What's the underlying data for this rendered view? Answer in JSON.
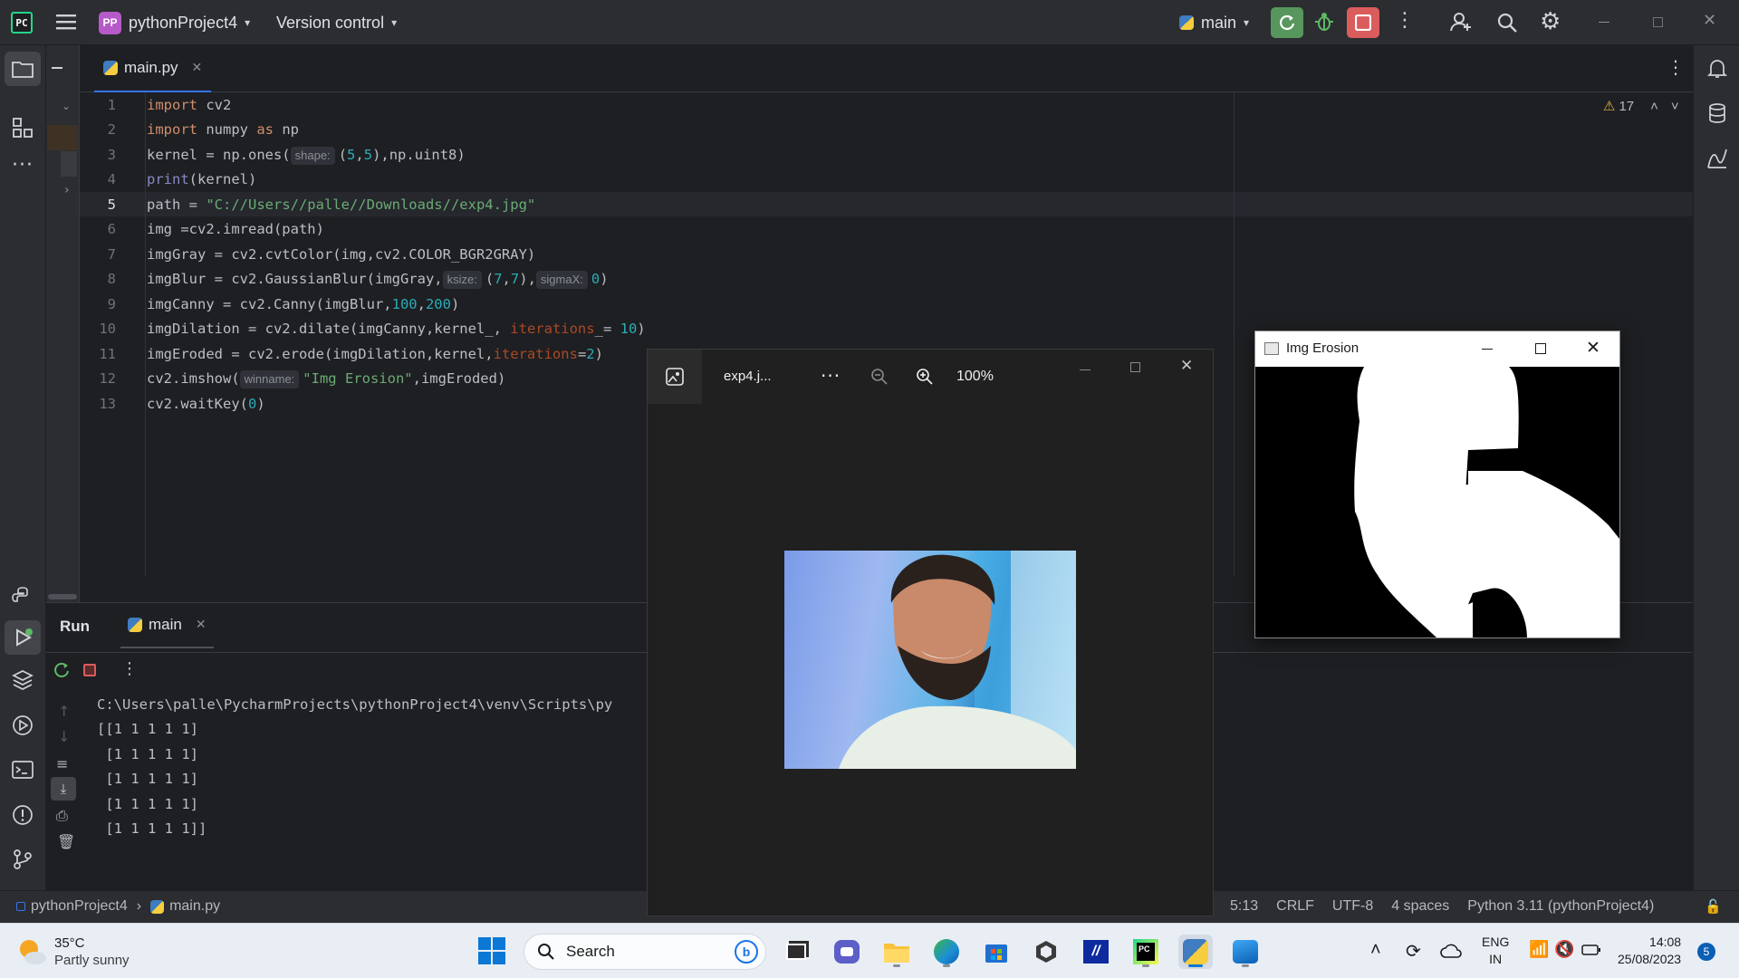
{
  "titlebar": {
    "project_badge": "PP",
    "project_name": "pythonProject4",
    "vcs_label": "Version control",
    "run_config": "main",
    "colors": {
      "accent_green": "#57965c",
      "stop_red": "#db5c5c",
      "badge_purple": "#b659c9"
    }
  },
  "editor": {
    "tab_label": "main.py",
    "warnings_count": "17",
    "lines": [
      {
        "n": "1"
      },
      {
        "n": "2"
      },
      {
        "n": "3"
      },
      {
        "n": "4"
      },
      {
        "n": "5"
      },
      {
        "n": "6"
      },
      {
        "n": "7"
      },
      {
        "n": "8"
      },
      {
        "n": "9"
      },
      {
        "n": "10"
      },
      {
        "n": "11"
      },
      {
        "n": "12"
      },
      {
        "n": "13"
      }
    ],
    "code": {
      "l1_kw": "import",
      "l1_rest": " cv2",
      "l2_kw": "import",
      "l2_mid": " numpy ",
      "l2_as": "as",
      "l2_rest": " np",
      "l3_a": "kernel = np.ones(",
      "l3_hint": "shape:",
      "l3_b": "(",
      "l3_n1": "5",
      "l3_c": ",",
      "l3_n2": "5",
      "l3_d": "),np.uint8)",
      "l4_fn": "print",
      "l4_rest": "(kernel)",
      "l5_a": "path = ",
      "l5_str": "\"C://Users//palle//Downloads//exp4.jpg\"",
      "l6": "img =cv2.imread(path)",
      "l7": "imgGray = cv2.cvtColor(img,cv2.COLOR_BGR2GRAY)",
      "l8_a": "imgBlur = cv2.GaussianBlur(imgGray,",
      "l8_hint1": "ksize:",
      "l8_b": "(",
      "l8_n1": "7",
      "l8_c": ",",
      "l8_n2": "7",
      "l8_d": "),",
      "l8_hint2": "sigmaX:",
      "l8_n3": "0",
      "l8_e": ")",
      "l9_a": "imgCanny = cv2.Canny(imgBlur,",
      "l9_n1": "100",
      "l9_b": ",",
      "l9_n2": "200",
      "l9_c": ")",
      "l10_a": "imgDilation = cv2.dilate(imgCanny,kernel_, ",
      "l10_par": "iterations",
      "l10_b": "_= ",
      "l10_n": "10",
      "l10_c": ")",
      "l11_a": "imgEroded = cv2.erode(imgDilation,kernel,",
      "l11_par": "iterations",
      "l11_b": "=",
      "l11_n": "2",
      "l11_c": ")",
      "l12_a": "cv2.imshow(",
      "l12_hint": "winname:",
      "l12_str": "\"Img Erosion\"",
      "l12_b": ",imgEroded)",
      "l13_a": "cv2.waitKey(",
      "l13_n": "0",
      "l13_b": ")"
    }
  },
  "run": {
    "title": "Run",
    "tab_label": "main",
    "output": [
      "C:\\Users\\palle\\PycharmProjects\\pythonProject4\\venv\\Scripts\\py",
      "[[1 1 1 1 1]",
      " [1 1 1 1 1]",
      " [1 1 1 1 1]",
      " [1 1 1 1 1]",
      " [1 1 1 1 1]]"
    ]
  },
  "statusbar": {
    "crumb_project": "pythonProject4",
    "crumb_file": "main.py",
    "position": "5:13",
    "line_sep": "CRLF",
    "encoding": "UTF-8",
    "indent": "4 spaces",
    "interpreter": "Python 3.11 (pythonProject4)"
  },
  "viewer": {
    "file_name": "exp4.j...",
    "zoom": "100%"
  },
  "erosion": {
    "title": "Img Erosion"
  },
  "taskbar": {
    "weather_temp": "35°C",
    "weather_desc": "Partly sunny",
    "search_placeholder": "Search",
    "lang_1": "ENG",
    "lang_2": "IN",
    "time": "14:08",
    "date": "25/08/2023",
    "notif_count": "5"
  }
}
